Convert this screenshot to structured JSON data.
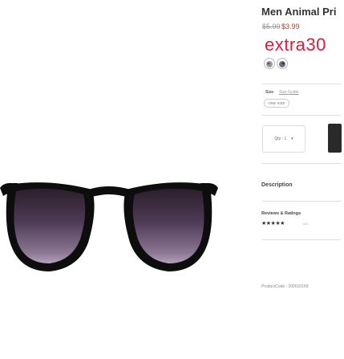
{
  "product": {
    "title": "Men Animal Pri",
    "old_price": "$5.99",
    "price": "$3.99",
    "promo": "extra30",
    "image_icon": "sunglasses-image"
  },
  "options": {
    "swatch_icon": "pattern-swatch-icon",
    "size_label": "Size",
    "size_guide": "Size Guide",
    "size_value": "ONE SIZE"
  },
  "purchase": {
    "qty_label": "Qty : 1",
    "qty_arrow": "▾"
  },
  "sections": {
    "description": "Description",
    "reviews": "Reviews & Ratings",
    "stars": "★★★★★",
    "rating_value": "4.5"
  },
  "meta": {
    "product_code": "ProductCode : 200010169;"
  },
  "colors": {
    "promo": "#d4213d",
    "frame": "#0d0d0d",
    "cart_button": "#2a2a2a"
  }
}
